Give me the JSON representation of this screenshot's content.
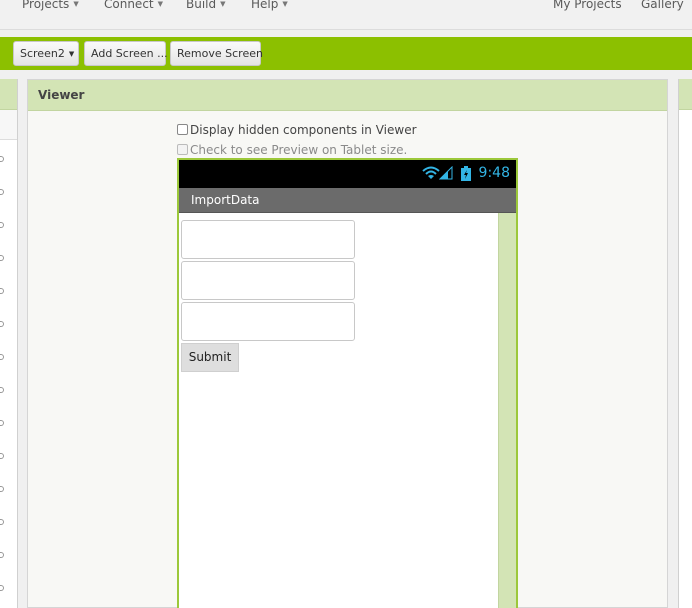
{
  "menu": {
    "projects": "Projects",
    "connect": "Connect",
    "build": "Build",
    "help": "Help",
    "my_projects": "My Projects",
    "gallery": "Gallery"
  },
  "toolbar": {
    "screen_select": "Screen2",
    "add_screen": "Add Screen ...",
    "remove_screen": "Remove Screen"
  },
  "viewer": {
    "title": "Viewer",
    "display_hidden_label": "Display hidden components in Viewer",
    "display_hidden_checked": false,
    "tablet_preview_label": "Check to see Preview on Tablet size.",
    "tablet_preview_checked": false
  },
  "phone": {
    "time": "9:48",
    "app_title": "ImportData",
    "submit_label": "Submit"
  },
  "colors": {
    "brand_green": "#8cc000",
    "panel_header": "#d3e4b5",
    "status_time": "#33b5e5",
    "app_bar": "#6b6b6b"
  }
}
